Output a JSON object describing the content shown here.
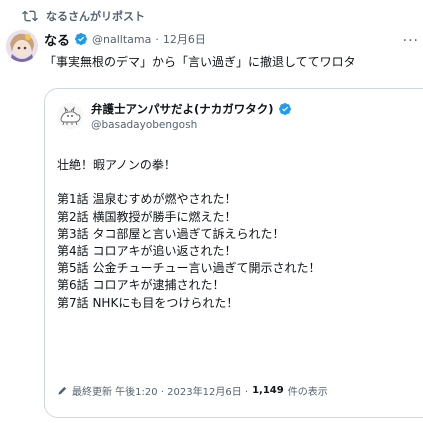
{
  "repost": {
    "text": "なるさんがリポスト",
    "icon": "repost-icon"
  },
  "tweet": {
    "display_name": "なる",
    "handle": "@nalltama",
    "separator": "·",
    "date": "12月6日",
    "text": "「事実無根のデマ」から「言い過ぎ」に撤退しててワロタ",
    "more_icon": "more-icon",
    "verified_color": "#1d9bf0"
  },
  "quote": {
    "display_name": "弁護士アンパサだよ(ナカガワタク)",
    "handle": "@basadayobengosh",
    "lines": [
      "壮絶！暇アノンの拳！",
      "",
      "第1話 温泉むすめが燃やされた！",
      "第2話 横国教授が勝手に燃えた！",
      "第3話 タコ部屋と言い過ぎて訴えられた！",
      "第4話 コロアキが追い返された！",
      "第5話 公金チューチュー言い過ぎて開示された！",
      "第6話 コロアキが逮捕された！",
      "第7話 NHKにも目をつけられた！"
    ],
    "footer": {
      "updated": "最終更新 午後1:20 · 2023年12月6日 · ",
      "views": "1,149",
      "views_suffix": " 件の表示"
    }
  }
}
